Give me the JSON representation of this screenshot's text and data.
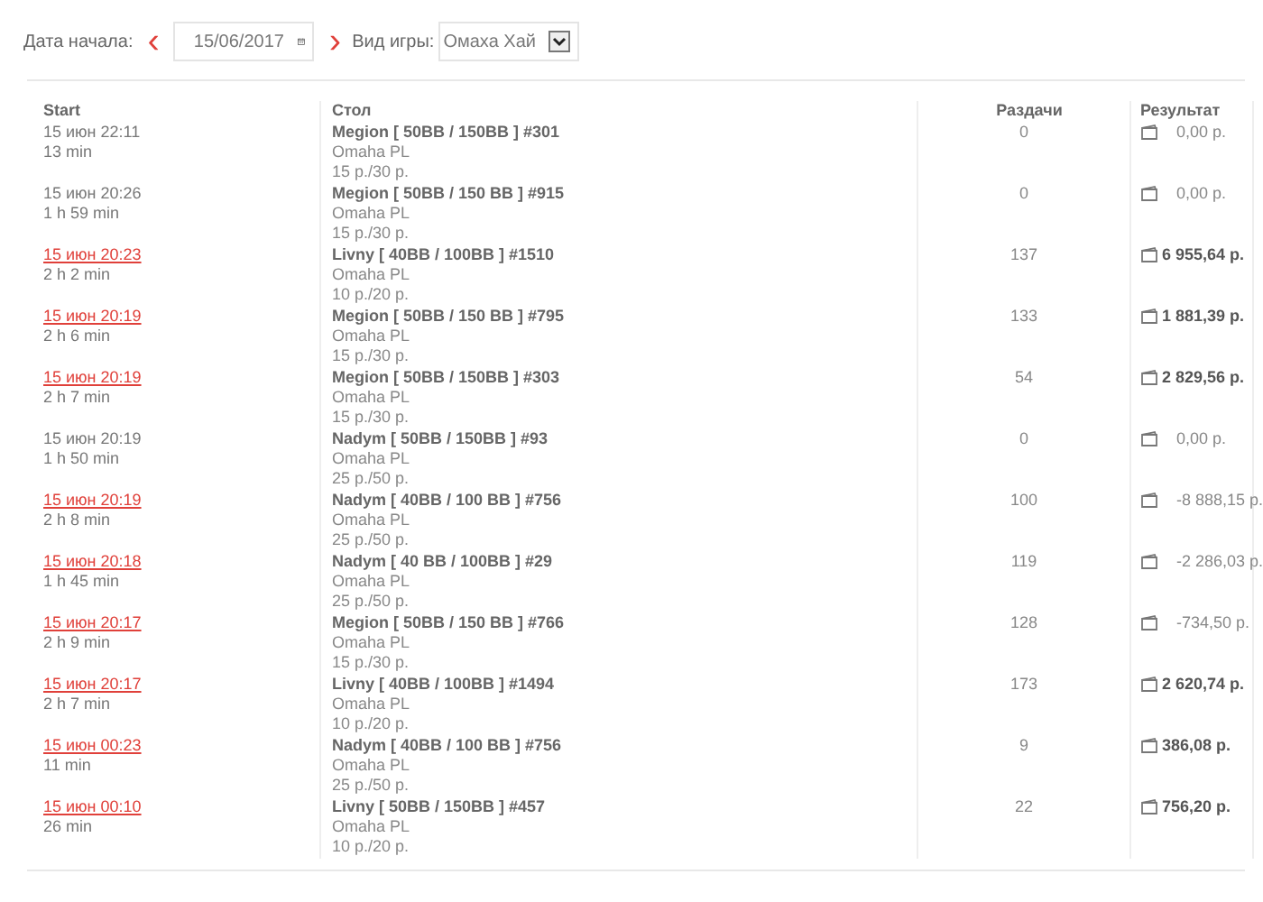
{
  "filter": {
    "date_label": "Дата начала:",
    "prev": "‹",
    "date": "15/06/2017",
    "next": "›",
    "game_label": "Вид игры:",
    "game": "Омаха Хай"
  },
  "table": {
    "columns": [
      "Start",
      "Стол",
      "Раздачи",
      "Результат"
    ],
    "rows": [
      {
        "start": "15 июн 22:11",
        "link": false,
        "duration": "13 min",
        "table": "Megion [ 50BB / 150BB ] #301",
        "game": "Omaha PL",
        "stakes": "15 р./30 р.",
        "hands": "0",
        "result": "0,00 р.",
        "bold": false
      },
      {
        "start": "15 июн 20:26",
        "link": false,
        "duration": "1 h 59 min",
        "table": "Megion [ 50BB / 150 BB ] #915",
        "game": "Omaha PL",
        "stakes": "15 р./30 р.",
        "hands": "0",
        "result": "0,00 р.",
        "bold": false
      },
      {
        "start": "15 июн 20:23",
        "link": true,
        "duration": "2 h 2 min",
        "table": "Livny [ 40BB / 100BB ] #1510",
        "game": "Omaha PL",
        "stakes": "10 р./20 р.",
        "hands": "137",
        "result": "6 955,64 р.",
        "bold": true
      },
      {
        "start": "15 июн 20:19",
        "link": true,
        "duration": "2 h 6 min",
        "table": "Megion [ 50BB / 150 BB ] #795",
        "game": "Omaha PL",
        "stakes": "15 р./30 р.",
        "hands": "133",
        "result": "1 881,39 р.",
        "bold": true
      },
      {
        "start": "15 июн 20:19",
        "link": true,
        "duration": "2 h 7 min",
        "table": "Megion [ 50BB / 150BB ] #303",
        "game": "Omaha PL",
        "stakes": "15 р./30 р.",
        "hands": "54",
        "result": "2 829,56 р.",
        "bold": true
      },
      {
        "start": "15 июн 20:19",
        "link": false,
        "duration": "1 h 50 min",
        "table": "Nadym [ 50BB / 150BB ] #93",
        "game": "Omaha PL",
        "stakes": "25 р./50 р.",
        "hands": "0",
        "result": "0,00 р.",
        "bold": false
      },
      {
        "start": "15 июн 20:19",
        "link": true,
        "duration": "2 h 8 min",
        "table": "Nadym [ 40BB / 100 BB ] #756",
        "game": "Omaha PL",
        "stakes": "25 р./50 р.",
        "hands": "100",
        "result": "-8 888,15 р.",
        "bold": false
      },
      {
        "start": "15 июн 20:18",
        "link": true,
        "duration": "1 h 45 min",
        "table": "Nadym [ 40 BB / 100BB ] #29",
        "game": "Omaha PL",
        "stakes": "25 р./50 р.",
        "hands": "119",
        "result": "-2 286,03 р.",
        "bold": false
      },
      {
        "start": "15 июн 20:17",
        "link": true,
        "duration": "2 h 9 min",
        "table": "Megion [ 50BB / 150 BB ] #766",
        "game": "Omaha PL",
        "stakes": "15 р./30 р.",
        "hands": "128",
        "result": "-734,50 р.",
        "bold": false
      },
      {
        "start": "15 июн 20:17",
        "link": true,
        "duration": "2 h 7 min",
        "table": "Livny [ 40BB / 100BB ] #1494",
        "game": "Omaha PL",
        "stakes": "10 р./20 р.",
        "hands": "173",
        "result": "2 620,74 р.",
        "bold": true
      },
      {
        "start": "15 июн 00:23",
        "link": true,
        "duration": "11 min",
        "table": "Nadym [ 40BB / 100 BB ] #756",
        "game": "Omaha PL",
        "stakes": "25 р./50 р.",
        "hands": "9",
        "result": "386,08 р.",
        "bold": true
      },
      {
        "start": "15 июн 00:10",
        "link": true,
        "duration": "26 min",
        "table": "Livny [ 50BB / 150BB ] #457",
        "game": "Omaha PL",
        "stakes": "10 р./20 р.",
        "hands": "22",
        "result": "756,20 р.",
        "bold": true
      }
    ]
  }
}
